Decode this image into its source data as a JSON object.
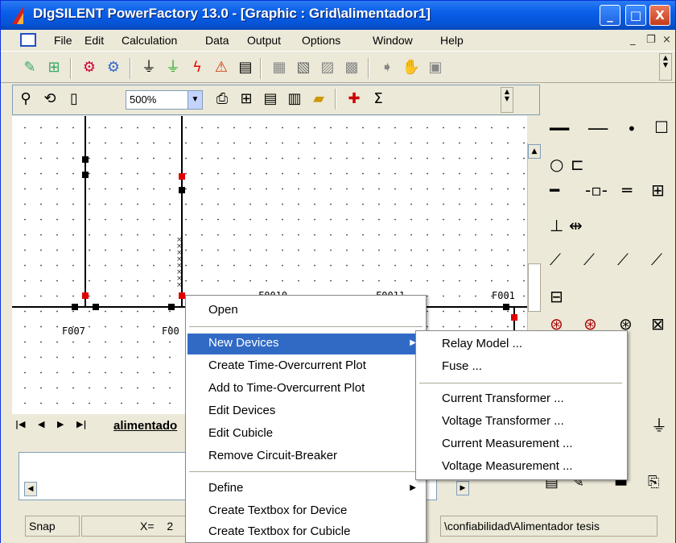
{
  "window": {
    "title": "DIgSILENT PowerFactory 13.0 - [Graphic : Grid\\alimentador1]",
    "minimize_glyph": "_",
    "maximize_glyph": "□",
    "close_glyph": "X"
  },
  "menubar": {
    "items": [
      "File",
      "Edit",
      "Calculation",
      "Data",
      "Output",
      "Options",
      "Window",
      "Help"
    ],
    "mdi_minimize": "_",
    "mdi_restore": "❐",
    "mdi_close": "×"
  },
  "toolbar": {
    "icons": [
      "edit-data-icon",
      "network-data-icon",
      "load-flow-icon",
      "short-circuit-icon",
      "harmonics-icon",
      "simulation-icon",
      "fault-icon",
      "reliability-icon",
      "report-icon",
      "graph-icon",
      "study-case-icon",
      "options-icon",
      "copy-icon",
      "stop-icon",
      "hand-icon",
      "calc-icon"
    ]
  },
  "graphic_toolbar": {
    "zoom_value": "500%",
    "sum_glyph": "Σ"
  },
  "canvas": {
    "labels": {
      "f007": "F007",
      "f00_partial": "F00",
      "f0010": "F0010",
      "f0011": "F0011",
      "f001_partial": "F001"
    }
  },
  "tabs": {
    "active_label": "alimentado"
  },
  "statusbar": {
    "snap": "Snap",
    "x_label": "X=",
    "x_value": "2",
    "path": "\\confiabilidad\\Alimentador tesis"
  },
  "context_menu": {
    "items": {
      "open": "Open",
      "new_devices": "New Devices",
      "create_plot": "Create Time-Overcurrent Plot",
      "add_plot": "Add to Time-Overcurrent Plot",
      "edit_devices": "Edit Devices",
      "edit_cubicle": "Edit Cubicle",
      "remove_breaker": "Remove Circuit-Breaker",
      "define": "Define",
      "textbox_device": "Create Textbox for Device",
      "textbox_cubicle": "Create Textbox for Cubicle"
    },
    "highlighted": "New Devices"
  },
  "submenu": {
    "items": {
      "relay": "Relay Model ...",
      "fuse": "Fuse ...",
      "ct": "Current Transformer ...",
      "vt": "Voltage Transformer ...",
      "cm": "Current Measurement ...",
      "vm": "Voltage Measurement ..."
    }
  },
  "colors": {
    "titlebar": "#0a5ee8",
    "highlight": "#316ac5",
    "node_red": "#e00000"
  }
}
